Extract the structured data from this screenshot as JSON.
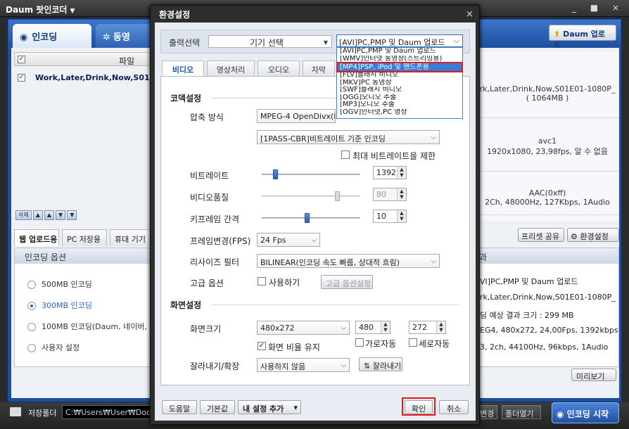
{
  "app": {
    "title": "Daum 팟인코더",
    "window_controls": "_ ■ ×"
  },
  "main": {
    "tabs": [
      "인코딩",
      "동영"
    ],
    "daum_upload": "Daum 업로드",
    "list_header": "파일",
    "file_name": "Work,Later,Drink,Now,S01E",
    "list_buttons": [
      "삭제",
      "▲",
      "▲",
      "▼",
      "▼"
    ],
    "info_rows": [
      [
        "rk,Later,Drink,Now,S01E01-1080P_",
        "( 1064MB )"
      ],
      [
        "avc1",
        "1920x1080, 23,98fps, 알 수 없음"
      ],
      [
        "AAC(0xff)",
        "2Ch, 48000Hz, 127Kbps, 1Audio"
      ]
    ],
    "subtabs": [
      "웹 업로드용",
      "PC 저장용",
      "휴대 기기"
    ],
    "preset_share": "프리셋 공유",
    "env_settings": "환경설정",
    "options_title": "인코딩 옵션",
    "radios": [
      "500MB 인코딩",
      "300MB 인코딩",
      "100MB 인코딩(Daum, 네이버,",
      "사용자 설정"
    ],
    "result_title": "과",
    "result_lines": [
      "VI]PC,PMP 및 Daum 업로드",
      "rk,Later,Drink,Now,S01E01-1080P_",
      "딩 예상 결과 크기 : 299 MB",
      "EG4, 480x272, 24,00Fps, 1392kbps",
      "3, 2ch, 44100Hz, 96kbps, 1Audio"
    ],
    "preview": "미리보기",
    "save_folder_label": "저장폴더",
    "save_path": "C:₩Users₩User₩Docun",
    "change": "변경",
    "open_folder": "폴더열기",
    "start": "인코딩 시작"
  },
  "dialog": {
    "title": "환경설정",
    "close": "×",
    "output_label": "출력선택",
    "device_select": "기기 선택",
    "format_selected": "[AVI]PC,PMP 및 Daum 업로드",
    "format_options": [
      "[AVI]PC,PMP 및 Daum 업로드",
      "[WMV]인터넷 동영상(스트리밍용)",
      "[MP4]PSP, iPod 및 핸드폰용",
      "[FLV]플래시 비디오",
      "[MKV]PC 동영상",
      "[SWF]플래시 비디오",
      "[OGG]오디오 추출",
      "[MP3]오디오 추출",
      "[OGV]인터넷,PC 영상"
    ],
    "tabs": [
      "비디오",
      "영상처리",
      "오디오",
      "자막"
    ],
    "codec_section": "코덱설정",
    "compress_label": "압축 방식",
    "compress_value": "MPEG-4 OpenDivx(Di",
    "pass_value": "[1PASS-CBR]비트레이트 기준 인코딩",
    "max_bitrate_limit": "최대 비트레이트을 제한",
    "bitrate_label": "비트레이트",
    "bitrate_value": "1392",
    "quality_label": "비디오품질",
    "quality_value": "80",
    "keyframe_label": "키프레임 간격",
    "keyframe_value": "10",
    "fps_label": "프레임변경(FPS)",
    "fps_value": "24 Fps",
    "resize_label": "리사이즈 필터",
    "resize_value": "BILINEAR(인코딩 속도 빠름, 상대적 흐림)",
    "adv_label": "고급 옵션",
    "use_label": "사용하기",
    "adv_settings": "고급 옵션설정",
    "screen_section": "화면설정",
    "size_label": "화면크기",
    "size_value": "480x272",
    "width_value": "480",
    "height_value": "272",
    "keep_ratio": "화면 비율 유지",
    "auto_w": "가로자동",
    "auto_h": "세로자동",
    "crop_label": "잘라내기/확장",
    "crop_value": "사용하지 않음",
    "crop_btn": "잘라내기",
    "help": "도움말",
    "defaults": "기본값",
    "my_settings": "내 설정 추가",
    "ok": "확인",
    "cancel": "취소"
  }
}
